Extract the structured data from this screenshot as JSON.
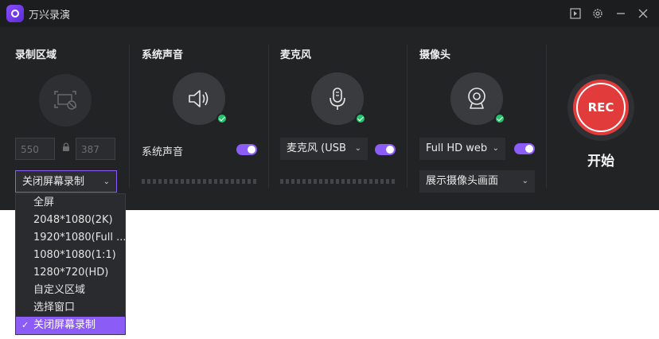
{
  "app": {
    "title": "万兴录演"
  },
  "titlebar_icons": [
    "sidebar-toggle-icon",
    "settings-icon",
    "minimize-icon",
    "close-icon"
  ],
  "record_area": {
    "title": "录制区域",
    "icon": "screen-area-disabled-icon",
    "width": "550",
    "height": "387",
    "selected": "关闭屏幕录制",
    "options": [
      "全屏",
      "2048*1080(2K)",
      "1920*1080(Full ...",
      "1080*1080(1:1)",
      "1280*720(HD)",
      "自定义区域",
      "选择窗口",
      "关闭屏幕录制"
    ],
    "selected_index": 7
  },
  "system_audio": {
    "title": "系统声音",
    "label": "系统声音",
    "enabled": true
  },
  "microphone": {
    "title": "麦克风",
    "device": "麦克风 (USB",
    "enabled": true
  },
  "camera": {
    "title": "摄像头",
    "device": "Full HD web",
    "mode": "展示摄像头画面",
    "enabled": true
  },
  "record": {
    "button": "REC",
    "label": "开始"
  },
  "colors": {
    "accent": "#8b5cf6",
    "rec": "#e23b3b",
    "ok": "#27c26c",
    "panel": "#222325"
  }
}
